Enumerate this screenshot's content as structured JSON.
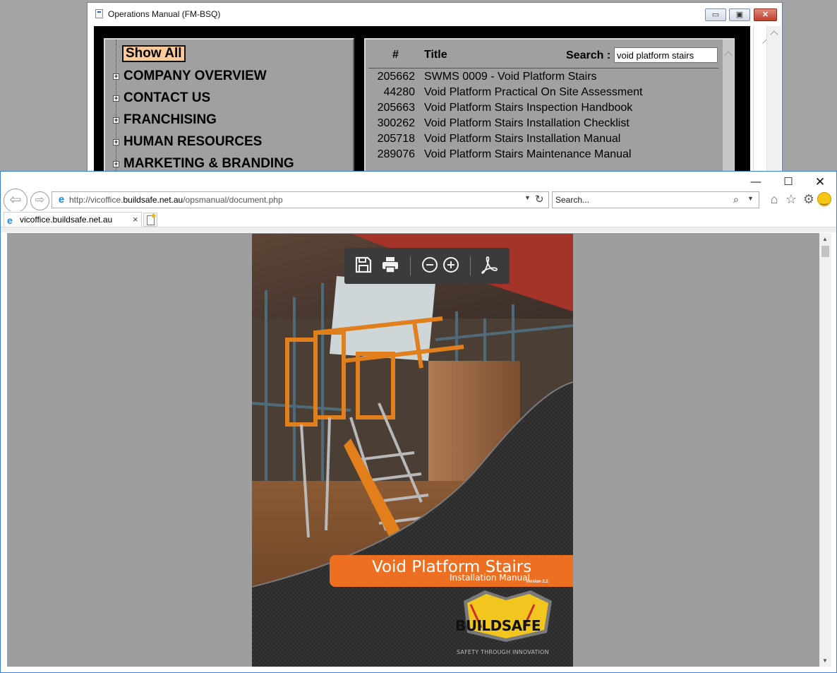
{
  "ops_window": {
    "title": "Operations Manual (FM-BSQ)",
    "controls": {
      "minimize": "▭",
      "maximize": "▣",
      "close": "✕"
    }
  },
  "nav": {
    "show_all": "Show All",
    "expander_glyph": "+",
    "items": [
      {
        "label": "COMPANY OVERVIEW"
      },
      {
        "label": "CONTACT US"
      },
      {
        "label": "FRANCHISING"
      },
      {
        "label": "HUMAN RESOURCES"
      },
      {
        "label": "MARKETING & BRANDING"
      }
    ]
  },
  "results": {
    "col_num": "#",
    "col_title": "Title",
    "search_label": "Search :",
    "search_value": "void platform stairs",
    "rows": [
      {
        "num": "205662",
        "title": "SWMS 0009 - Void Platform Stairs"
      },
      {
        "num": "44280",
        "title": "Void Platform Practical On Site Assessment"
      },
      {
        "num": "205663",
        "title": "Void Platform Stairs Inspection Handbook"
      },
      {
        "num": "300262",
        "title": "Void Platform Stairs Installation Checklist"
      },
      {
        "num": "205718",
        "title": "Void Platform Stairs Installation Manual"
      },
      {
        "num": "289076",
        "title": "Void Platform Stairs Maintenance Manual"
      }
    ]
  },
  "browser": {
    "controls": {
      "minimize": "—",
      "maximize": "☐",
      "close": "✕"
    },
    "back_glyph": "⇦",
    "forward_glyph": "⇨",
    "ie_glyph": "e",
    "url_prefix": "http://vicoffice.",
    "url_host": "buildsafe.net.au",
    "url_path": "/opsmanual/document.php",
    "dropdown_glyph": "▼",
    "refresh_glyph": "↻",
    "search_placeholder": "Search...",
    "search_glyph": "⌕",
    "home_glyph": "⌂",
    "favorites_glyph": "☆",
    "settings_glyph": "⚙",
    "tab_label": "vicoffice.buildsafe.net.au",
    "tab_close": "×",
    "scroll_up": "▲",
    "scroll_down": "▼"
  },
  "pdf": {
    "cover_title": "Void Platform Stairs",
    "cover_subtitle": "Installation Manual",
    "version": "Version 2.2",
    "brand": "BUILDSAFE",
    "tagline": "SAFETY THROUGH INNOVATION",
    "colors": {
      "banner": "#ec6f22",
      "brand_yellow": "#f2c61f",
      "toolbar": "#3b3b3b"
    },
    "toolbar_icons": [
      "save-icon",
      "print-icon",
      "zoom-out-icon",
      "zoom-in-icon",
      "acrobat-icon"
    ]
  }
}
